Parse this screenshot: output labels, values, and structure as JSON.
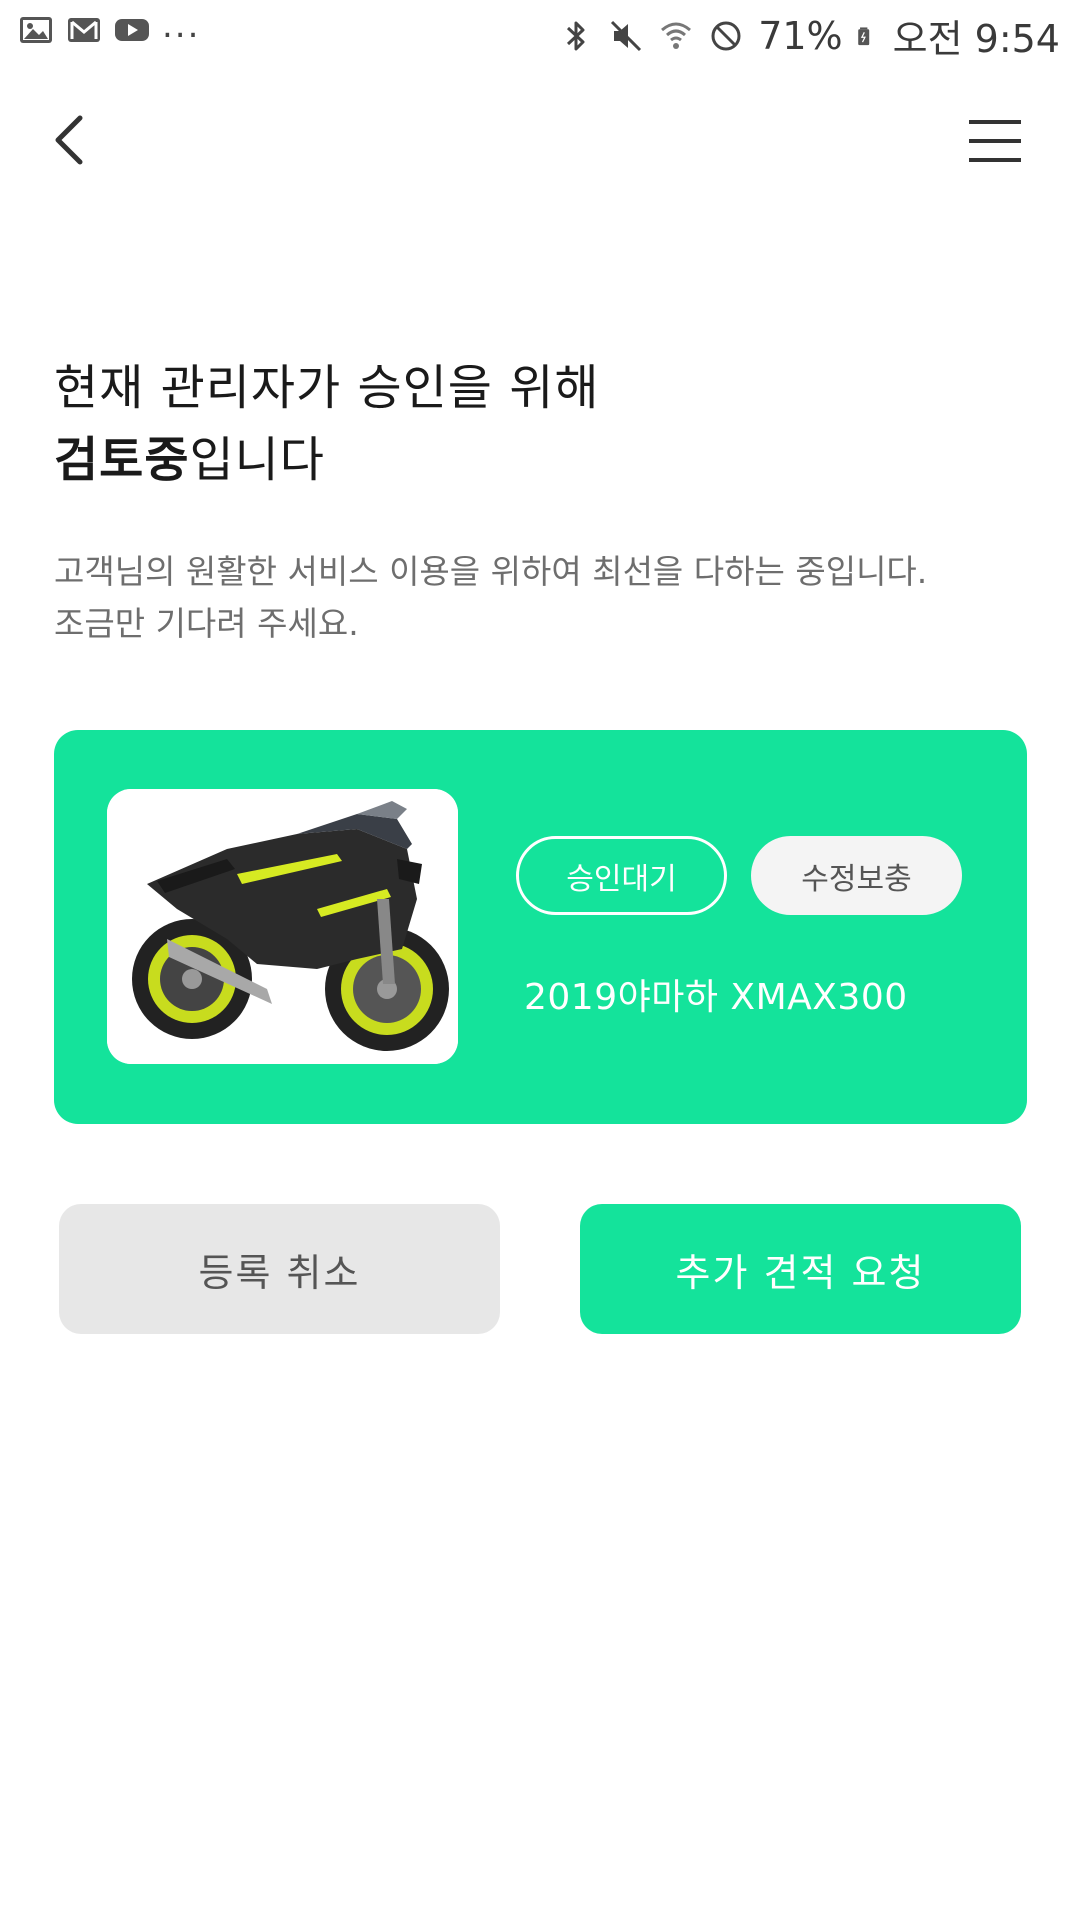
{
  "status_bar": {
    "left_icons": [
      "gallery-icon",
      "gmail-icon",
      "youtube-icon"
    ],
    "more": "...",
    "right_icons": [
      "bluetooth-icon",
      "mute-icon",
      "wifi-icon",
      "no-disturb-icon"
    ],
    "battery_percent": "71%",
    "time": "오전 9:54"
  },
  "header": {
    "back_icon": "chevron-left-icon",
    "menu_icon": "hamburger-menu-icon"
  },
  "main": {
    "headline_line1": "현재 관리자가 승인을 위해",
    "headline_bold": "검토중",
    "headline_rest": "입니다",
    "subtext_line1": "고객님의 원활한 서비스 이용을 위하여 최선을 다하는 중입니다.",
    "subtext_line2": "조금만 기다려 주세요."
  },
  "card": {
    "status_badge": "승인대기",
    "edit_button": "수정보충",
    "model_name": "2019야마하 XMAX300",
    "image_subject": "motorcycle-image"
  },
  "actions": {
    "cancel_label": "등록 취소",
    "quote_label": "추가 견적 요청"
  },
  "colors": {
    "accent": "#14e39b",
    "cancel_bg": "#e7e7e7"
  }
}
